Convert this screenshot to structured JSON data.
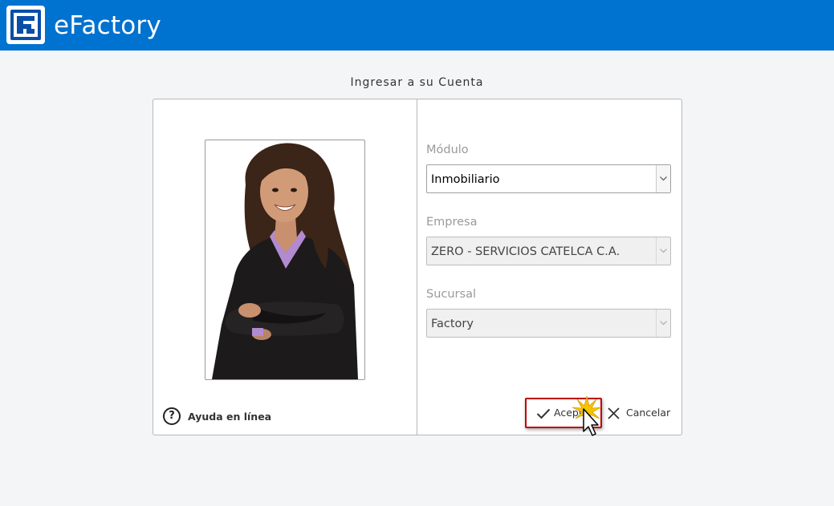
{
  "app": {
    "title": "eFactory",
    "accent_color": "#0072d0"
  },
  "login": {
    "title": "Ingresar a su Cuenta",
    "help_link": "Ayuda en línea",
    "fields": {
      "modulo": {
        "label": "Módulo",
        "value": "Inmobiliario",
        "enabled": true
      },
      "empresa": {
        "label": "Empresa",
        "value": "ZERO - SERVICIOS CATELCA C.A.",
        "enabled": false
      },
      "sucursal": {
        "label": "Sucursal",
        "value": "Factory",
        "enabled": false
      }
    },
    "buttons": {
      "accept": "Aceptar",
      "cancel": "Cancelar"
    }
  },
  "icons": {
    "logo": "efactory-logo-icon",
    "help": "help-circle-icon",
    "accept": "check-icon",
    "cancel": "close-icon",
    "dropdown": "chevron-down-icon",
    "cursor": "pointer-cursor-icon"
  }
}
